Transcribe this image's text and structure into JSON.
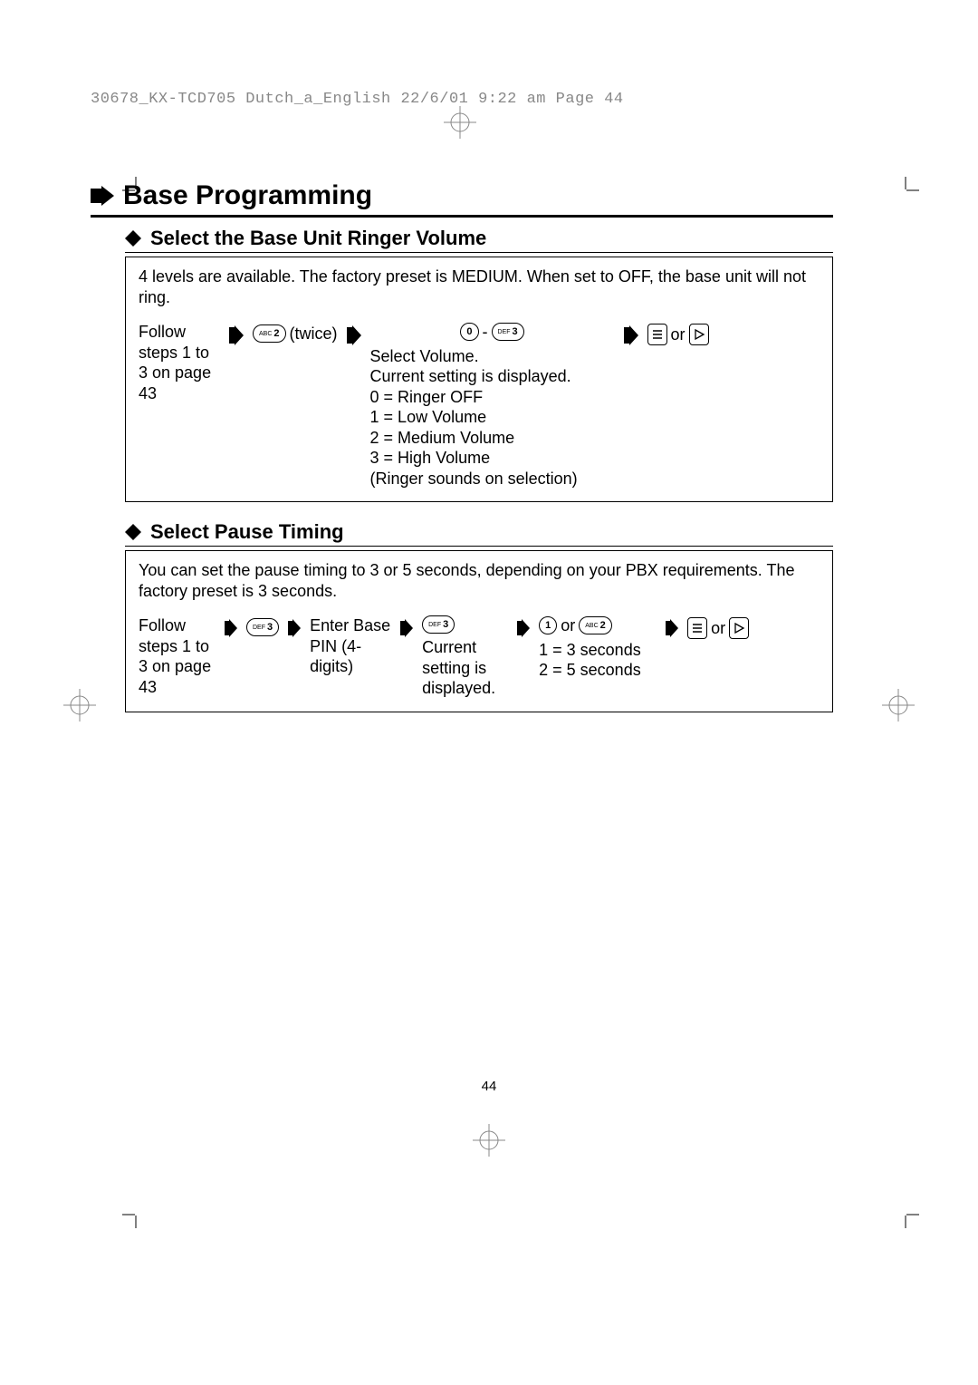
{
  "slug_line": "30678_KX-TCD705 Dutch_a_English  22/6/01  9:22 am  Page 44",
  "chapter_title": "Base Programming",
  "section1": {
    "title": "Select the Base Unit Ringer Volume",
    "intro": "4 levels are available. The factory preset is MEDIUM. When set to OFF, the base unit will not ring.",
    "step0": "Follow steps 1 to 3 on page 43",
    "twice": "(twice)",
    "select_line": "Select Volume.",
    "current_line": "Current setting is displayed.",
    "opt0": "0 = Ringer OFF",
    "opt1": "1 = Low Volume",
    "opt2": "2 = Medium Volume",
    "opt3": "3 = High Volume",
    "ringer_note": "(Ringer sounds on selection)",
    "or": "or"
  },
  "section2": {
    "title": "Select Pause Timing",
    "intro": "You can set the pause timing to 3 or 5 seconds, depending on your PBX requirements. The factory preset is 3 seconds.",
    "step0": "Follow steps 1 to 3 on page 43",
    "enter_pin": "Enter Base PIN (4-digits)",
    "current": "Current setting is displayed.",
    "or": "or",
    "opt1": "1 = 3 seconds",
    "opt2": "2 = 5 seconds",
    "or2": "or"
  },
  "keys": {
    "abc2_sup": "ABC",
    "abc2_main": "2",
    "def3_sup": "DEF",
    "def3_main": "3",
    "zero_main": "0",
    "one_main": "1"
  },
  "page_number": "44"
}
